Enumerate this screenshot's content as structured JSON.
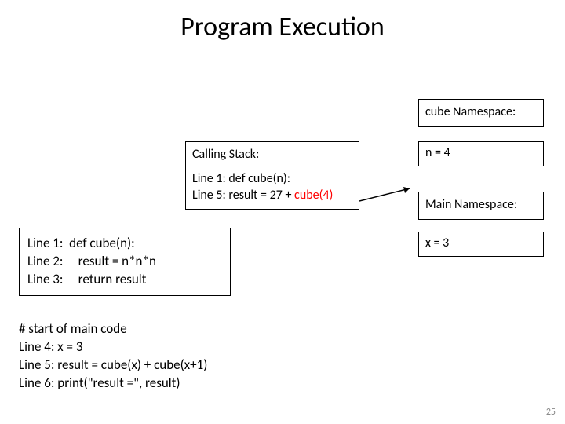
{
  "title": "Program Execution",
  "cube_ns_label": "cube Namespace:",
  "stack": {
    "title": "Calling Stack:",
    "line1": "Line 1: def cube(n):",
    "line5_prefix": "Line 5: result = 27 + ",
    "line5_call": "cube(4)"
  },
  "n_value": "n = 4",
  "main_ns_label": "Main Namespace:",
  "code1": {
    "l1_label": "Line 1:",
    "l1_code": "def cube(n):",
    "l2_label": "Line 2:",
    "l2_code": "result = n*n*n",
    "l3_label": "Line 3:",
    "l3_code": "return result"
  },
  "x_value": "x = 3",
  "code2": {
    "comment": "# start of main code",
    "l4": "Line 4:   x = 3",
    "l5": "Line 5:   result = cube(x) + cube(x+1)",
    "l6": "Line 6:   print(\"result =\", result)"
  },
  "page_number": "25"
}
